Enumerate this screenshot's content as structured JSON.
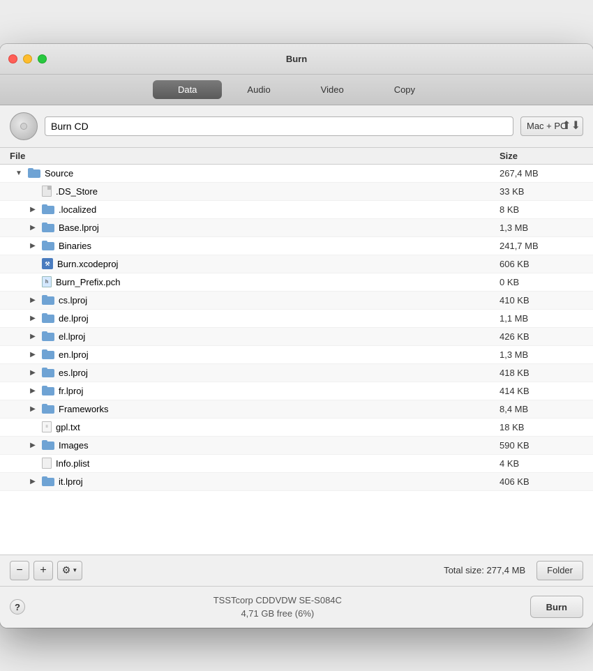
{
  "window": {
    "title": "Burn"
  },
  "tabs": [
    {
      "id": "data",
      "label": "Data",
      "active": true
    },
    {
      "id": "audio",
      "label": "Audio",
      "active": false
    },
    {
      "id": "video",
      "label": "Video",
      "active": false
    },
    {
      "id": "copy",
      "label": "Copy",
      "active": false
    }
  ],
  "toolbar": {
    "project_name": "Burn CD",
    "format": "Mac + PC"
  },
  "file_list": {
    "col_file": "File",
    "col_size": "Size",
    "rows": [
      {
        "name": "Source",
        "size": "267,4 MB",
        "indent": 0,
        "type": "folder",
        "disclosure": "open"
      },
      {
        "name": ".DS_Store",
        "size": "33 KB",
        "indent": 1,
        "type": "file-generic",
        "disclosure": "none"
      },
      {
        "name": ".localized",
        "size": "8 KB",
        "indent": 1,
        "type": "folder",
        "disclosure": "closed"
      },
      {
        "name": "Base.lproj",
        "size": "1,3 MB",
        "indent": 1,
        "type": "folder",
        "disclosure": "closed"
      },
      {
        "name": "Binaries",
        "size": "241,7 MB",
        "indent": 1,
        "type": "folder",
        "disclosure": "closed"
      },
      {
        "name": "Burn.xcodeproj",
        "size": "606 KB",
        "indent": 1,
        "type": "file-xcode",
        "disclosure": "none"
      },
      {
        "name": "Burn_Prefix.pch",
        "size": "0 KB",
        "indent": 1,
        "type": "file-h",
        "disclosure": "none"
      },
      {
        "name": "cs.lproj",
        "size": "410 KB",
        "indent": 1,
        "type": "folder",
        "disclosure": "closed"
      },
      {
        "name": "de.lproj",
        "size": "1,1 MB",
        "indent": 1,
        "type": "folder",
        "disclosure": "closed"
      },
      {
        "name": "el.lproj",
        "size": "426 KB",
        "indent": 1,
        "type": "folder",
        "disclosure": "closed"
      },
      {
        "name": "en.lproj",
        "size": "1,3 MB",
        "indent": 1,
        "type": "folder",
        "disclosure": "closed"
      },
      {
        "name": "es.lproj",
        "size": "418 KB",
        "indent": 1,
        "type": "folder",
        "disclosure": "closed"
      },
      {
        "name": "fr.lproj",
        "size": "414 KB",
        "indent": 1,
        "type": "folder",
        "disclosure": "closed"
      },
      {
        "name": "Frameworks",
        "size": "8,4 MB",
        "indent": 1,
        "type": "folder",
        "disclosure": "closed"
      },
      {
        "name": "gpl.txt",
        "size": "18 KB",
        "indent": 1,
        "type": "file-txt",
        "disclosure": "none"
      },
      {
        "name": "Images",
        "size": "590 KB",
        "indent": 1,
        "type": "folder",
        "disclosure": "closed"
      },
      {
        "name": "Info.plist",
        "size": "4 KB",
        "indent": 1,
        "type": "file-plist",
        "disclosure": "none"
      },
      {
        "name": "it.lproj",
        "size": "406 KB",
        "indent": 1,
        "type": "folder",
        "disclosure": "closed"
      }
    ]
  },
  "bottom_toolbar": {
    "minus_label": "−",
    "plus_label": "+",
    "gear_label": "⚙",
    "chevron_label": "▼",
    "total_size": "Total size: 277,4 MB",
    "folder_label": "Folder"
  },
  "status_bar": {
    "help_label": "?",
    "drive_name": "TSSTcorp CDDVDW SE-S084C",
    "drive_free": "4,71 GB free (6%)",
    "burn_label": "Burn"
  }
}
